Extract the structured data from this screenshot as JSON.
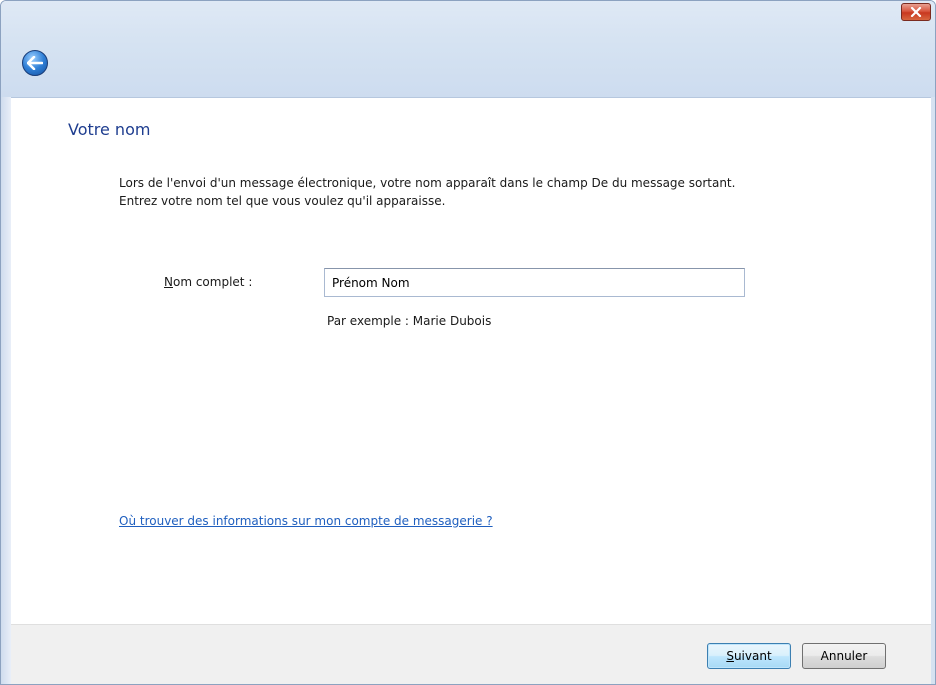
{
  "window": {
    "close_icon": "close-icon",
    "back_icon": "back-arrow-icon"
  },
  "page": {
    "heading": "Votre nom",
    "description_line1": "Lors de l'envoi d'un message électronique, votre nom apparaît dans le champ De du message sortant.",
    "description_line2": "Entrez votre nom tel que vous voulez qu'il apparaisse."
  },
  "form": {
    "full_name": {
      "label_mnemonic": "N",
      "label_rest": "om complet :",
      "value": "Prénom Nom",
      "hint": "Par exemple : Marie Dubois"
    }
  },
  "help_link": "Où trouver des informations sur mon compte de messagerie ?",
  "footer": {
    "next_mnemonic": "S",
    "next_rest": "uivant",
    "cancel_label": "Annuler"
  },
  "colors": {
    "heading": "#1e3d8f",
    "link": "#1f5fbf",
    "close_button": "#c8381f",
    "titlebar": "#d6e3f2"
  }
}
